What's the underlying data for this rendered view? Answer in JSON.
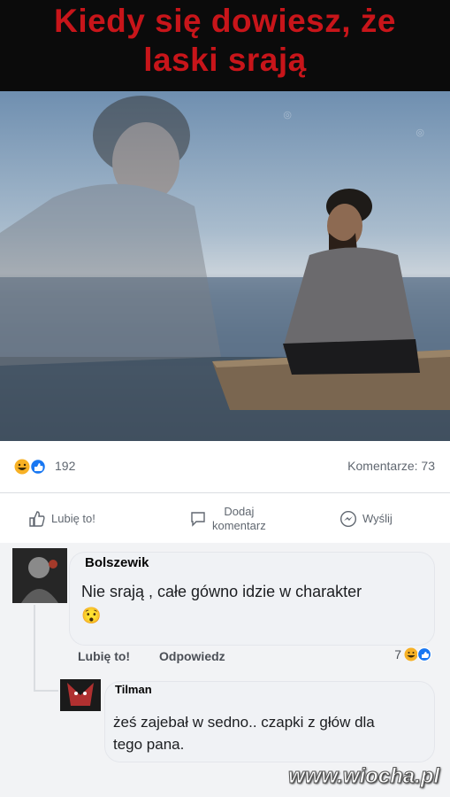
{
  "meme": {
    "line1": "Kiedy się dowiesz, że",
    "line2": "laski srają"
  },
  "post": {
    "reaction_count": "192",
    "comments_count": "Komentarze: 73",
    "actions": {
      "like": "Lubię to!",
      "comment_line1": "Dodaj",
      "comment_line2": "komentarz",
      "share": "Wyślij"
    }
  },
  "comments": [
    {
      "author": "Bolszewik",
      "text": "Nie srają , całe gówno idzie w charakter 😯",
      "like_label": "Lubię to!",
      "reply_label": "Odpowiedz",
      "reaction_count": "7"
    },
    {
      "author": "Tilman",
      "text": "żeś zajebał w sedno.. czapki z głów dla tego pana."
    }
  ],
  "site_watermark": "www.wiocha.pl",
  "colors": {
    "headline_red": "#c8151a",
    "like_blue": "#1877f2",
    "haha_yellow": "#f7b125"
  }
}
